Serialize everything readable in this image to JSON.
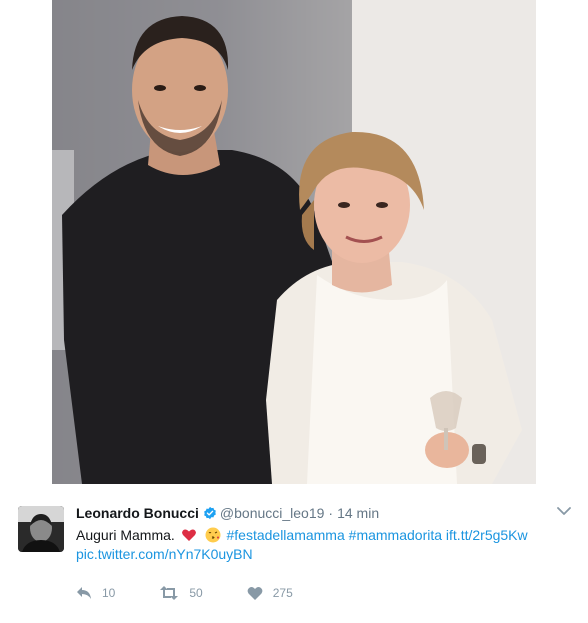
{
  "tweet": {
    "author_name": "Leonardo Bonucci",
    "verified_icon": "verified-badge-icon",
    "handle": "@bonucci_leo19",
    "separator": "·",
    "timestamp": "14 min",
    "text_prefix": "Auguri Mamma.",
    "emojis": [
      "heart-emoji",
      "kiss-emoji"
    ],
    "hashtags": [
      "#festadellamamma",
      "#mammadorita"
    ],
    "short_link": "ift.tt/2r5g5Kw",
    "media_link": "pic.twitter.com/nYn7K0uyBN",
    "actions": {
      "reply_count": "10",
      "retweet_count": "50",
      "like_count": "275"
    }
  },
  "colors": {
    "link": "#1b95e0",
    "muted": "#657786",
    "icon": "#8899a6",
    "verified": "#1da1f2"
  },
  "icons": [
    "reply-icon",
    "retweet-icon",
    "like-icon",
    "caret-down-icon"
  ]
}
